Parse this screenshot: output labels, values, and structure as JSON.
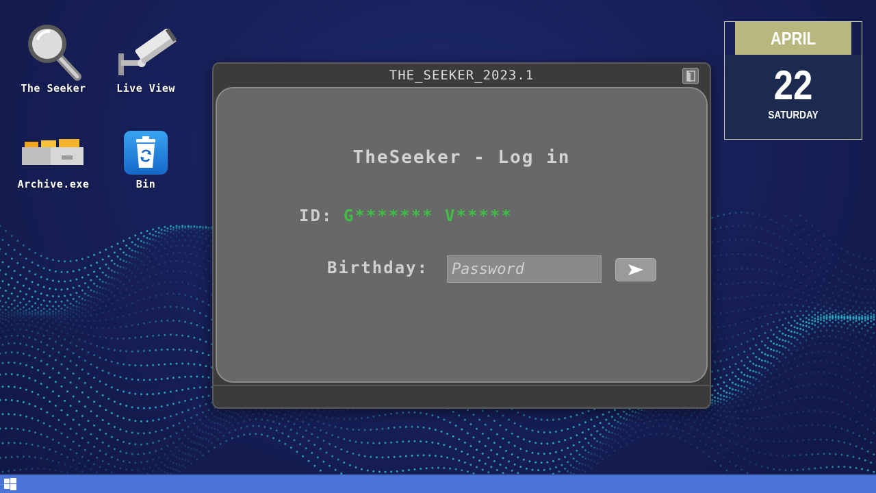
{
  "desktop": {
    "icons": [
      {
        "label": "The Seeker",
        "icon": "magnifier-icon"
      },
      {
        "label": "Live View",
        "icon": "security-camera-icon"
      },
      {
        "label": "Archive.exe",
        "icon": "file-drawer-icon"
      },
      {
        "label": "Bin",
        "icon": "recycle-bin-icon"
      }
    ]
  },
  "window": {
    "title": "THE_SEEKER_2023.1",
    "login_title": "TheSeeker - Log in",
    "id_label": "ID:",
    "id_value": "G******* V*****",
    "birthday_label": "Birthday:",
    "password_placeholder": "Password",
    "password_value": "",
    "submit_icon": "play-arrow-icon"
  },
  "calendar": {
    "month": "APRIL",
    "day": "22",
    "weekday": "SATURDAY"
  },
  "taskbar": {
    "start_icon": "windows-logo-icon"
  },
  "colors": {
    "background": "#172059",
    "dots": "#2fb8cf",
    "window_frame": "#3b3b3b",
    "window_body": "#686868",
    "id_value": "#3fbf46",
    "calendar_month_bg": "#b8b77e",
    "calendar_body_bg": "#1c2a4f",
    "taskbar": "#4a74d6"
  }
}
